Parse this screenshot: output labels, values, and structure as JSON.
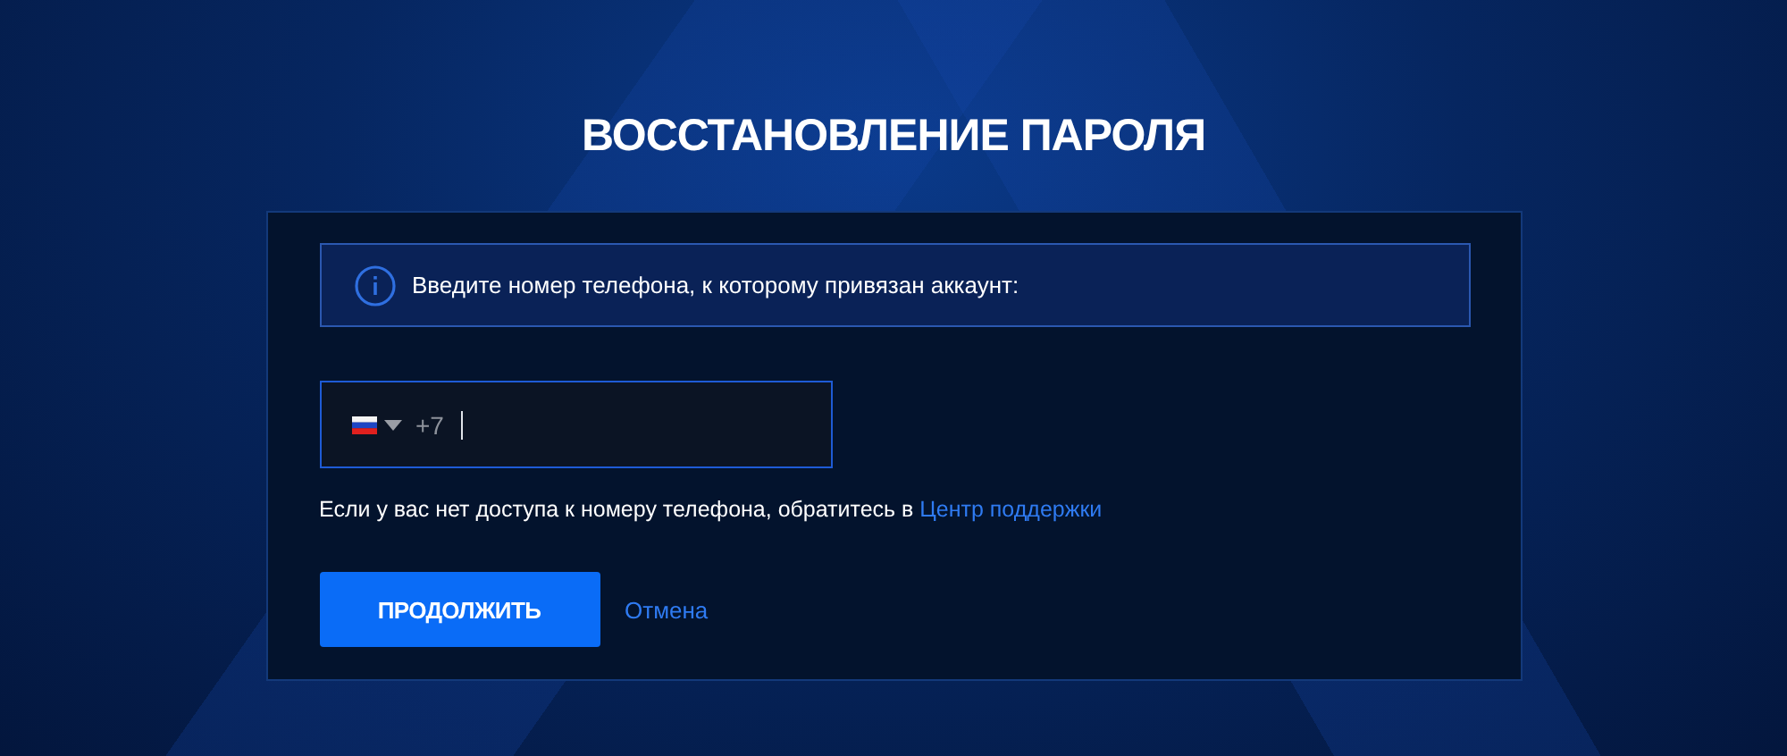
{
  "title": "ВОССТАНОВЛЕНИЕ ПАРОЛЯ",
  "info": {
    "text": "Введите номер телефона, к которому привязан аккаунт:"
  },
  "phone": {
    "prefix": "+7"
  },
  "help": {
    "text": "Если у вас нет доступа к номеру телефона, обратитесь в",
    "link": "Центр поддержки"
  },
  "buttons": {
    "submit": "ПРОДОЛЖИТЬ",
    "cancel": "Отмена"
  }
}
